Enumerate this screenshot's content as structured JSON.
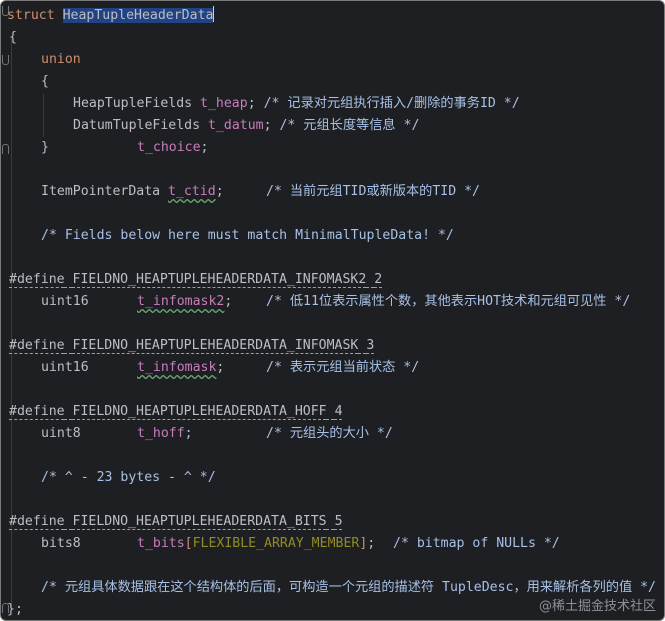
{
  "code": {
    "struct_kw": "struct",
    "struct_name": "HeapTupleHeaderData",
    "open_brace": "{",
    "union_kw": "union",
    "union_open": "{",
    "heap_type": "HeapTupleFields",
    "heap_field": "t_heap",
    "heap_comment": "/* 记录对元组执行插入/删除的事务ID */",
    "datum_type": "DatumTupleFields",
    "datum_field": "t_datum",
    "datum_comment": "/* 元组长度等信息 */",
    "union_close": "}",
    "choice_field": "t_choice",
    "ctid_type": "ItemPointerData",
    "ctid_field": "t_ctid",
    "ctid_comment": "/* 当前元组TID或新版本的TID */",
    "fields_comment": "/* Fields below here must match MinimalTupleData! */",
    "def1_kw": "#define",
    "def1_name": "FIELDNO_HEAPTUPLEHEADERDATA_INFOMASK2",
    "def1_val": "2",
    "im2_type": "uint16",
    "im2_field": "t_infomask2",
    "im2_comment": "/* 低11位表示属性个数，其他表示HOT技术和元组可见性 */",
    "def2_kw": "#define",
    "def2_name": "FIELDNO_HEAPTUPLEHEADERDATA_INFOMASK",
    "def2_val": "3",
    "im_type": "uint16",
    "im_field": "t_infomask",
    "im_comment": "/* 表示元组当前状态 */",
    "def3_kw": "#define",
    "def3_name": "FIELDNO_HEAPTUPLEHEADERDATA_HOFF",
    "def3_val": "4",
    "hoff_type": "uint8",
    "hoff_field": "t_hoff",
    "hoff_comment": "/* 元组头的大小 */",
    "bytes_comment": "/* ^ - 23 bytes - ^ */",
    "def4_kw": "#define",
    "def4_name": "FIELDNO_HEAPTUPLEHEADERDATA_BITS",
    "def4_val": "5",
    "bits_type": "bits8",
    "bits_field": "t_bits",
    "bits_bracket_open": "[",
    "bits_macro": "FLEXIBLE_ARRAY_MEMBER",
    "bits_bracket_close": "]",
    "bits_comment": "/* bitmap of NULLs */",
    "tail_comment": "/* 元组具体数据跟在这个结构体的后面，可构造一个元组的描述符 TupleDesc，用来解析各列的值 */",
    "close_brace": "};"
  },
  "watermark": "@稀土掘金技术社区",
  "colors": {
    "background": "#1e1f22",
    "keyword": "#cf8e6d",
    "field": "#c77dbb",
    "comment": "#7a7e85",
    "macro": "#908b25",
    "selection": "#214283"
  }
}
